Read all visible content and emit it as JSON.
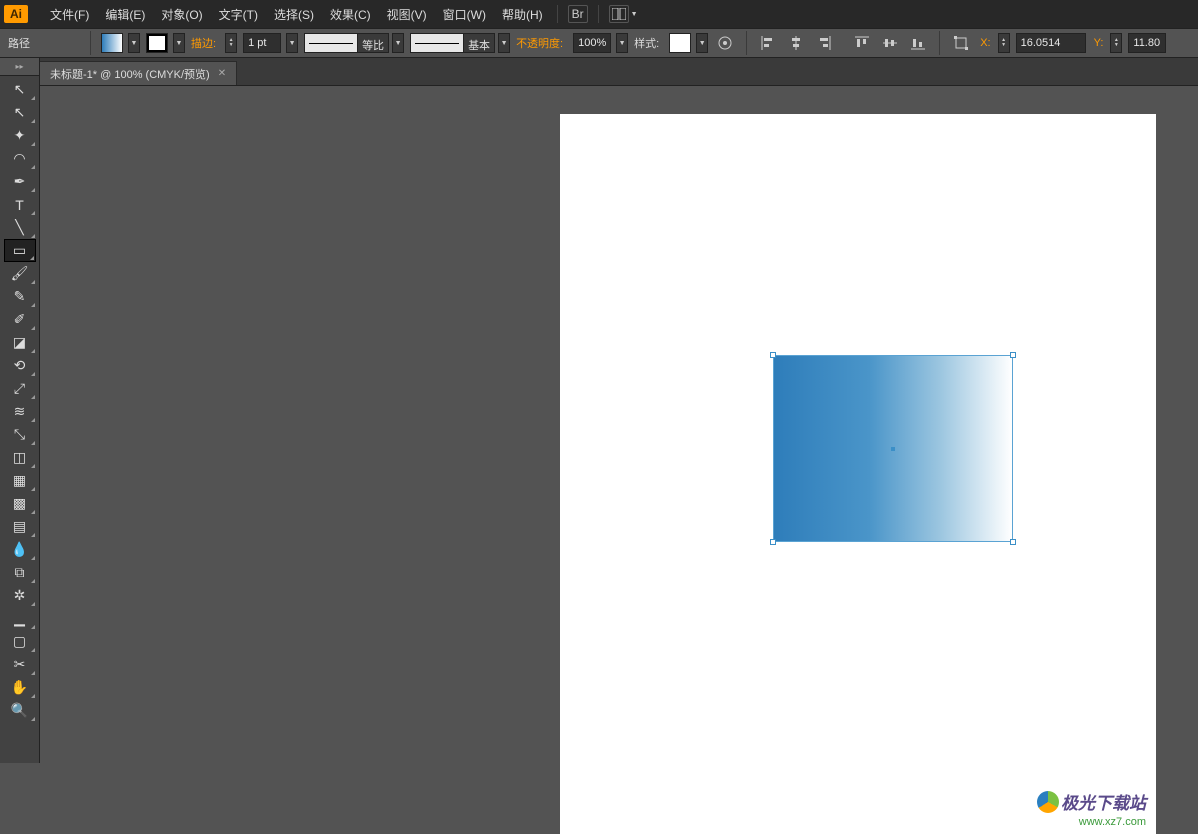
{
  "app_logo_text": "Ai",
  "menu": {
    "file": "文件(F)",
    "edit": "编辑(E)",
    "object": "对象(O)",
    "type": "文字(T)",
    "select": "选择(S)",
    "effect": "效果(C)",
    "view": "视图(V)",
    "window": "窗口(W)",
    "help": "帮助(H)",
    "br_icon": "Br"
  },
  "control": {
    "path_label": "路径",
    "stroke_label": "描边:",
    "stroke_weight": "1 pt",
    "stroke_profile": "等比",
    "brush_label": "基本",
    "opacity_label": "不透明度:",
    "opacity_value": "100%",
    "style_label": "样式:",
    "x_label": "X:",
    "x_value": "16.0514",
    "y_label": "Y:",
    "y_value": "11.80"
  },
  "document_tab": "未标题-1* @ 100% (CMYK/预览)",
  "tools": [
    {
      "name": "selection-tool",
      "glyph": "↖"
    },
    {
      "name": "direct-selection-tool",
      "glyph": "↖"
    },
    {
      "name": "magic-wand-tool",
      "glyph": "✦"
    },
    {
      "name": "lasso-tool",
      "glyph": "◠"
    },
    {
      "name": "pen-tool",
      "glyph": "✒"
    },
    {
      "name": "type-tool",
      "glyph": "T"
    },
    {
      "name": "line-segment-tool",
      "glyph": "╲"
    },
    {
      "name": "rectangle-tool",
      "glyph": "▭",
      "selected": true
    },
    {
      "name": "paintbrush-tool",
      "glyph": "🖌"
    },
    {
      "name": "pencil-tool",
      "glyph": "✎"
    },
    {
      "name": "blob-brush-tool",
      "glyph": "✐"
    },
    {
      "name": "eraser-tool",
      "glyph": "◪"
    },
    {
      "name": "rotate-tool",
      "glyph": "⟲"
    },
    {
      "name": "scale-tool",
      "glyph": "⤢"
    },
    {
      "name": "width-tool",
      "glyph": "≋"
    },
    {
      "name": "free-transform-tool",
      "glyph": "⤡"
    },
    {
      "name": "shape-builder-tool",
      "glyph": "◫"
    },
    {
      "name": "perspective-grid-tool",
      "glyph": "▦"
    },
    {
      "name": "mesh-tool",
      "glyph": "▩"
    },
    {
      "name": "gradient-tool",
      "glyph": "▤"
    },
    {
      "name": "eyedropper-tool",
      "glyph": "💧"
    },
    {
      "name": "blend-tool",
      "glyph": "⧉"
    },
    {
      "name": "symbol-sprayer-tool",
      "glyph": "✲"
    },
    {
      "name": "column-graph-tool",
      "glyph": "▁"
    },
    {
      "name": "artboard-tool",
      "glyph": "▢"
    },
    {
      "name": "slice-tool",
      "glyph": "✂"
    },
    {
      "name": "hand-tool",
      "glyph": "✋"
    },
    {
      "name": "zoom-tool",
      "glyph": "🔍"
    }
  ],
  "watermark": {
    "title": "极光下载站",
    "url": "www.xz7.com"
  },
  "colors": {
    "accent": "#ff9a00",
    "fill_gradient_start": "#2e7dba",
    "fill_gradient_end": "#ffffff"
  }
}
